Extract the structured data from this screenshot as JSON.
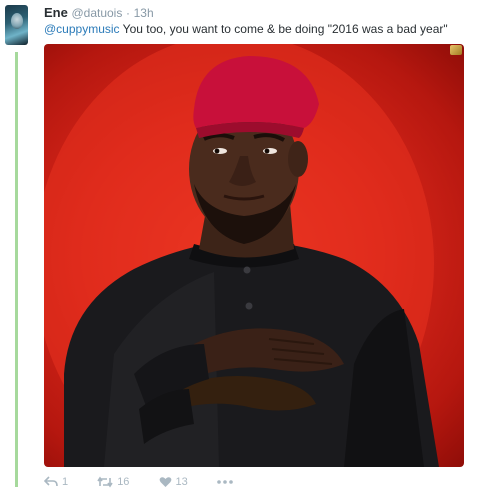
{
  "tweet": {
    "author_name": "Ene",
    "author_handle": "@datuois",
    "separator": "·",
    "timestamp": "13h",
    "mention": "@cuppymusic",
    "body": " You too, you want to come & be doing \"2016 was a bad year\"",
    "media_icon": "photo-man-red-cap",
    "actions": {
      "reply_count": "1",
      "retweet_count": "16",
      "like_count": "13"
    }
  },
  "colors": {
    "thread_line": "#a6d99c",
    "mention": "#2b7bb9",
    "media_background": "#d8261a"
  }
}
